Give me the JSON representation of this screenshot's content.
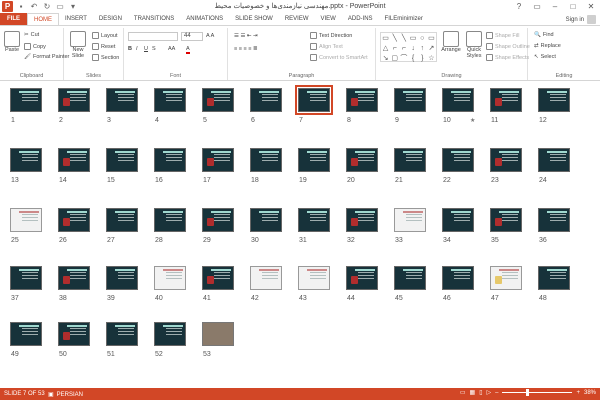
{
  "window": {
    "title": "مهندسی نیازمندی‌ها و خصوصیات محیط.pptx - PowerPoint",
    "qat": [
      "save-icon",
      "undo-icon",
      "redo-icon",
      "present-icon",
      "customize-icon"
    ],
    "controls": [
      "?",
      "▭",
      "–",
      "□",
      "✕"
    ]
  },
  "tabs": [
    "FILE",
    "HOME",
    "INSERT",
    "DESIGN",
    "TRANSITIONS",
    "ANIMATIONS",
    "SLIDE SHOW",
    "REVIEW",
    "VIEW",
    "ADD-INS",
    "FILEminimizer"
  ],
  "signin": "Sign in",
  "ribbon": {
    "clipboard": {
      "label": "Clipboard",
      "paste": "Paste",
      "cut": "Cut",
      "copy": "Copy",
      "format_painter": "Format Painter"
    },
    "slides": {
      "label": "Slides",
      "new_slide": "New Slide",
      "layout": "Layout",
      "reset": "Reset",
      "section": "Section"
    },
    "font": {
      "label": "Font",
      "size": "44",
      "bold": "B",
      "italic": "I",
      "underline": "U",
      "strike": "S",
      "aa": "AA"
    },
    "paragraph": {
      "label": "Paragraph",
      "text_direction": "Text Direction",
      "align_text": "Align Text",
      "smartart": "Convert to SmartArt"
    },
    "drawing": {
      "label": "Drawing",
      "arrange": "Arrange",
      "quick_styles": "Quick Styles",
      "shape_fill": "Shape Fill",
      "shape_outline": "Shape Outline",
      "shape_effects": "Shape Effects",
      "shapes": [
        "▭",
        "╲",
        "╲",
        "▭",
        "○",
        "▭",
        "△",
        "⌐",
        "⌐",
        "↓",
        "↑",
        "↗",
        "↘",
        "▢",
        "⌒",
        "{",
        "}",
        "☆"
      ]
    },
    "editing": {
      "label": "Editing",
      "find": "Find",
      "replace": "Replace",
      "select": "Select"
    }
  },
  "sorter": {
    "selected_slide": 7,
    "slides": [
      {
        "n": "1"
      },
      {
        "n": "2"
      },
      {
        "n": "3"
      },
      {
        "n": "4"
      },
      {
        "n": "5"
      },
      {
        "n": "6"
      },
      {
        "n": "7"
      },
      {
        "n": "8"
      },
      {
        "n": "9"
      },
      {
        "n": "10",
        "star": "★"
      },
      {
        "n": "11"
      },
      {
        "n": "12"
      },
      {
        "n": "13"
      },
      {
        "n": "14"
      },
      {
        "n": "15"
      },
      {
        "n": "16"
      },
      {
        "n": "17"
      },
      {
        "n": "18"
      },
      {
        "n": "19"
      },
      {
        "n": "20"
      },
      {
        "n": "21"
      },
      {
        "n": "22"
      },
      {
        "n": "23"
      },
      {
        "n": "24"
      },
      {
        "n": "25",
        "style": "light"
      },
      {
        "n": "26"
      },
      {
        "n": "27"
      },
      {
        "n": "28"
      },
      {
        "n": "29"
      },
      {
        "n": "30"
      },
      {
        "n": "31"
      },
      {
        "n": "32"
      },
      {
        "n": "33",
        "style": "light"
      },
      {
        "n": "34"
      },
      {
        "n": "35"
      },
      {
        "n": "36"
      },
      {
        "n": "37"
      },
      {
        "n": "38"
      },
      {
        "n": "39"
      },
      {
        "n": "40",
        "style": "light"
      },
      {
        "n": "41"
      },
      {
        "n": "42",
        "style": "light"
      },
      {
        "n": "43",
        "style": "light"
      },
      {
        "n": "44"
      },
      {
        "n": "45"
      },
      {
        "n": "46"
      },
      {
        "n": "47",
        "style": "light"
      },
      {
        "n": "48"
      },
      {
        "n": "49"
      },
      {
        "n": "50"
      },
      {
        "n": "51"
      },
      {
        "n": "52"
      },
      {
        "n": "53",
        "style": "photo"
      }
    ]
  },
  "status": {
    "slide_info": "SLIDE 7 OF 53",
    "language": "PERSIAN",
    "zoom": "38%"
  },
  "colors": {
    "accent": "#d24726",
    "slide_bg": "#17323a"
  }
}
